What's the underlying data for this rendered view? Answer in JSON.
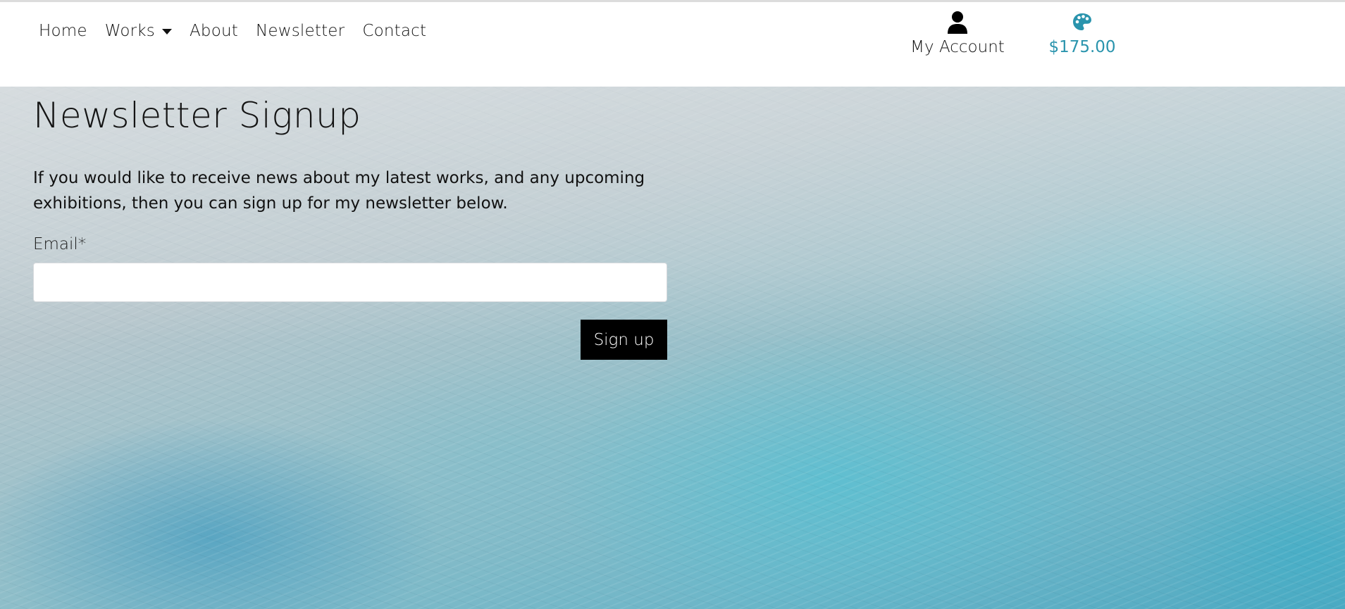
{
  "nav": {
    "links": [
      "Home",
      "Works",
      "About",
      "Newsletter",
      "Contact"
    ]
  },
  "account": {
    "label": "My Account",
    "icon": "user-icon"
  },
  "cart": {
    "total": "$175.00",
    "icon": "palette-icon",
    "color": "#2a94ad"
  },
  "main": {
    "title": "Newsletter Signup",
    "intro": "If you would like to receive news about my latest works, and any upcoming exhibitions, then you can sign up for my newsletter below.",
    "form": {
      "email_label": "Email*",
      "email_value": "",
      "submit_label": "Sign up"
    }
  },
  "colors": {
    "accent": "#2a94ad",
    "button": "#000000"
  }
}
